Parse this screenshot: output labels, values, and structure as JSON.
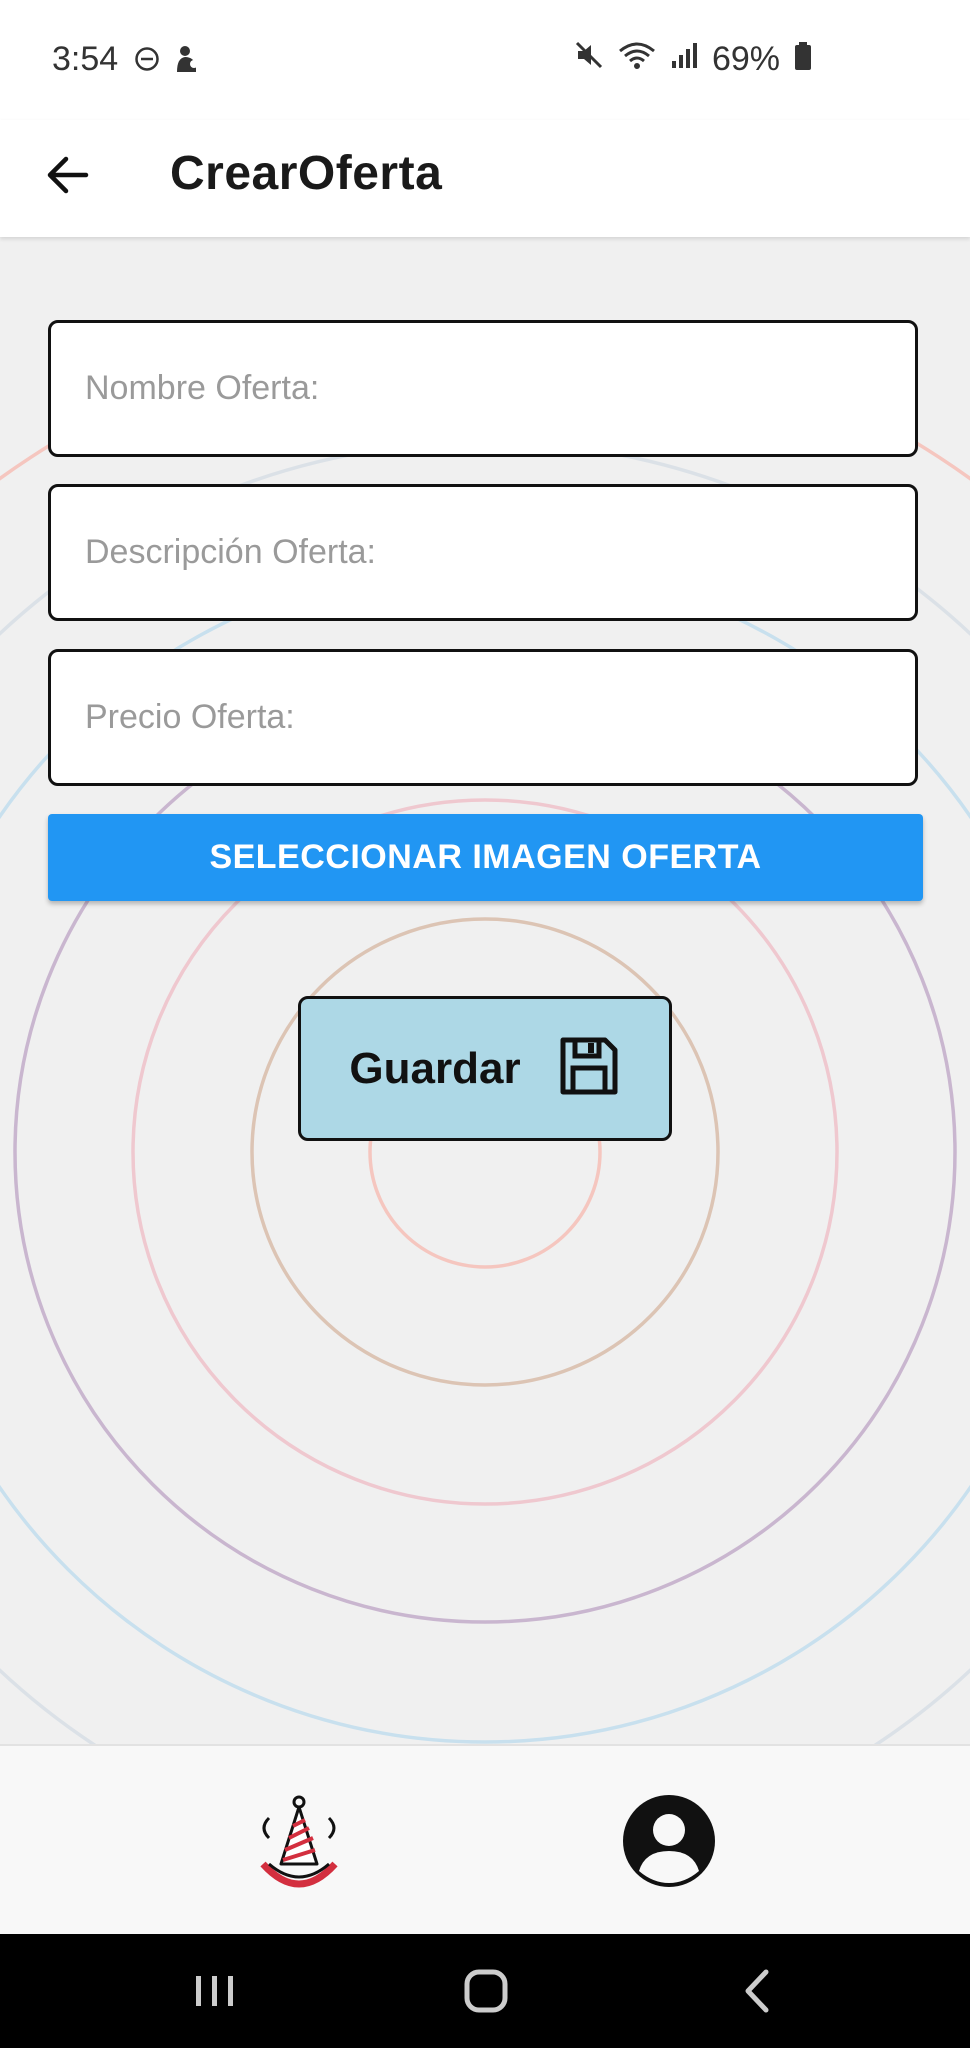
{
  "status_bar": {
    "time": "3:54",
    "battery": "69%",
    "icons": [
      "do-not-disturb-icon",
      "notification-icon",
      "mute-icon",
      "wifi-icon",
      "signal-icon",
      "battery-icon"
    ]
  },
  "app_bar": {
    "title": "CrearOferta",
    "back_icon": "back-arrow-icon"
  },
  "form": {
    "name_placeholder": "Nombre Oferta:",
    "name_value": "",
    "description_placeholder": "Descripción Oferta:",
    "description_value": "",
    "price_placeholder": "Precio Oferta:",
    "price_value": "",
    "select_image_label": "SELECCIONAR IMAGEN OFERTA",
    "save_label": "Guardar",
    "save_icon": "floppy-disk-icon"
  },
  "bottom_nav": {
    "items": [
      {
        "icon": "party-hat-logo-icon"
      },
      {
        "icon": "user-profile-icon"
      }
    ]
  },
  "system_nav": {
    "buttons": [
      "recents-icon",
      "home-icon",
      "back-icon"
    ]
  },
  "colors": {
    "primary_button": "#2196f3",
    "save_button": "#add8e6",
    "background": "#f0f0f0"
  }
}
